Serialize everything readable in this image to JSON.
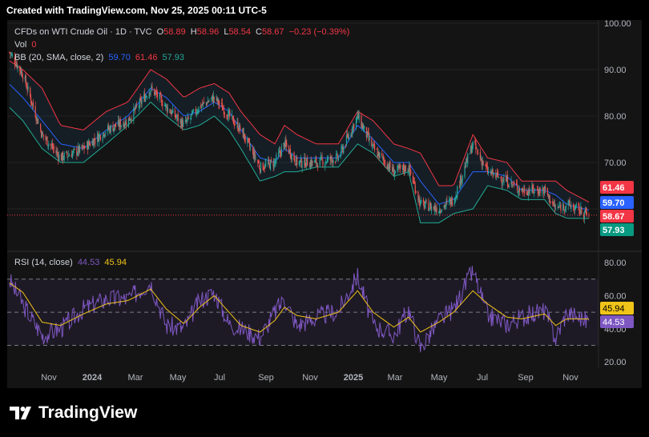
{
  "header": {
    "created_text": "Created with TradingView.com, Nov 25, 2025 00:11 UTC-5"
  },
  "legend": {
    "symbol": "CFDs on WTI Crude Oil · 1D · TVC",
    "ohlc": {
      "o_label": "O",
      "o": "58.89",
      "h_label": "H",
      "h": "58.96",
      "l_label": "L",
      "l": "58.54",
      "c_label": "C",
      "c": "58.67",
      "change": "−0.23 (−0.39%)"
    },
    "vol_label": "Vol",
    "vol": "0",
    "bb_label": "BB (20, SMA, close, 2)",
    "bb_mid": "59.70",
    "bb_upper": "61.46",
    "bb_lower": "57.93",
    "rsi_label": "RSI (14, close)",
    "rsi_value": "44.53",
    "rsi_ma": "45.94"
  },
  "colors": {
    "up": "#26a69a",
    "down": "#ef5350",
    "bb_upper": "#f23645",
    "bb_mid": "#2962ff",
    "bb_lower": "#22ab94",
    "rsi": "#7e57c2",
    "rsi_ma": "#f0c419",
    "background": "#141414"
  },
  "branding": {
    "logo_text": "TradingView"
  },
  "chart_data": [
    {
      "type": "candlestick",
      "title": "CFDs on WTI Crude Oil · 1D · TVC",
      "y_ticks": [
        "100.00",
        "90.00",
        "80.00",
        "70.00"
      ],
      "ylim": [
        50,
        100
      ],
      "x_ticks": [
        "Nov",
        "2024",
        "Mar",
        "May",
        "Jul",
        "Sep",
        "Nov",
        "2025",
        "Mar",
        "May",
        "Jul",
        "Sep",
        "Nov"
      ],
      "price_labels": {
        "bb_upper": "61.46",
        "bb_mid": "59.70",
        "last_close": "58.67",
        "bb_lower": "57.93"
      },
      "series": [
        {
          "name": "BB (20, SMA, close, 2)",
          "anchors": [
            [
              "2023-10-01",
              92,
              87,
              82
            ],
            [
              "2023-10-20",
              90,
              84,
              79
            ],
            [
              "2023-11-15",
              86,
              79,
              73
            ],
            [
              "2023-12-10",
              78,
              74,
              70
            ],
            [
              "2024-01-10",
              77,
              73,
              70
            ],
            [
              "2024-02-10",
              81,
              77,
              74
            ],
            [
              "2024-03-10",
              83,
              80,
              78
            ],
            [
              "2024-04-10",
              90,
              86,
              83
            ],
            [
              "2024-05-01",
              88,
              84,
              80
            ],
            [
              "2024-05-25",
              84,
              80,
              77
            ],
            [
              "2024-06-15",
              86,
              81,
              78
            ],
            [
              "2024-07-05",
              87,
              83,
              80
            ],
            [
              "2024-07-25",
              85,
              81,
              77
            ],
            [
              "2024-08-10",
              81,
              77,
              73
            ],
            [
              "2024-09-05",
              76,
              71,
              66
            ],
            [
              "2024-09-25",
              74,
              70,
              67
            ],
            [
              "2024-10-08",
              78,
              73,
              68
            ],
            [
              "2024-10-25",
              76,
              71,
              68
            ],
            [
              "2024-11-20",
              74,
              71,
              69
            ],
            [
              "2024-12-20",
              74,
              71,
              69
            ],
            [
              "2025-01-15",
              81,
              78,
              74
            ],
            [
              "2025-02-05",
              79,
              75,
              72
            ],
            [
              "2025-03-05",
              74,
              70,
              67
            ],
            [
              "2025-03-25",
              73,
              70,
              68
            ],
            [
              "2025-04-10",
              72,
              66,
              57
            ],
            [
              "2025-05-05",
              65,
              61,
              57
            ],
            [
              "2025-05-25",
              65,
              62,
              59
            ],
            [
              "2025-06-20",
              76,
              68,
              60
            ],
            [
              "2025-07-10",
              71,
              68,
              65
            ],
            [
              "2025-08-05",
              70,
              67,
              64
            ],
            [
              "2025-08-25",
              66,
              64,
              62
            ],
            [
              "2025-09-25",
              66,
              64,
              62
            ],
            [
              "2025-10-10",
              66,
              63,
              59
            ],
            [
              "2025-10-25",
              64,
              61,
              58
            ],
            [
              "2025-11-24",
              61.46,
              59.7,
              57.93
            ]
          ]
        },
        {
          "name": "close",
          "anchors": [
            [
              "2023-10-01",
              94
            ],
            [
              "2023-10-20",
              89
            ],
            [
              "2023-11-15",
              76
            ],
            [
              "2023-12-10",
              71
            ],
            [
              "2024-01-10",
              73
            ],
            [
              "2024-02-10",
              77
            ],
            [
              "2024-03-10",
              79
            ],
            [
              "2024-04-10",
              86
            ],
            [
              "2024-05-01",
              82
            ],
            [
              "2024-05-25",
              78
            ],
            [
              "2024-06-15",
              82
            ],
            [
              "2024-07-05",
              84
            ],
            [
              "2024-07-25",
              80
            ],
            [
              "2024-08-10",
              77
            ],
            [
              "2024-09-05",
              69
            ],
            [
              "2024-09-25",
              70
            ],
            [
              "2024-10-08",
              74
            ],
            [
              "2024-10-25",
              70
            ],
            [
              "2024-11-20",
              70
            ],
            [
              "2024-12-20",
              71
            ],
            [
              "2025-01-15",
              80
            ],
            [
              "2025-02-05",
              73
            ],
            [
              "2025-03-05",
              68
            ],
            [
              "2025-03-25",
              69
            ],
            [
              "2025-04-10",
              61
            ],
            [
              "2025-05-05",
              60
            ],
            [
              "2025-05-25",
              62
            ],
            [
              "2025-06-20",
              74
            ],
            [
              "2025-07-10",
              68
            ],
            [
              "2025-08-05",
              66
            ],
            [
              "2025-08-25",
              64
            ],
            [
              "2025-09-25",
              64
            ],
            [
              "2025-10-10",
              60
            ],
            [
              "2025-10-25",
              61
            ],
            [
              "2025-11-24",
              58.67
            ]
          ]
        }
      ]
    },
    {
      "type": "line",
      "title": "RSI (14, close)",
      "y_ticks": [
        "80.00",
        "60.00",
        "40.00",
        "20.00"
      ],
      "ylim": [
        20,
        80
      ],
      "bands": [
        30,
        50,
        70
      ],
      "value_labels": {
        "rsi_ma": "45.94",
        "rsi": "44.53"
      },
      "series": [
        {
          "name": "RSI",
          "anchors": [
            [
              "2023-10-01",
              70
            ],
            [
              "2023-10-20",
              55
            ],
            [
              "2023-11-15",
              36
            ],
            [
              "2023-12-10",
              40
            ],
            [
              "2024-01-10",
              52
            ],
            [
              "2024-02-10",
              58
            ],
            [
              "2024-03-10",
              58
            ],
            [
              "2024-04-10",
              68
            ],
            [
              "2024-05-01",
              42
            ],
            [
              "2024-05-25",
              40
            ],
            [
              "2024-06-15",
              57
            ],
            [
              "2024-07-05",
              62
            ],
            [
              "2024-07-25",
              43
            ],
            [
              "2024-08-10",
              40
            ],
            [
              "2024-09-05",
              35
            ],
            [
              "2024-09-25",
              50
            ],
            [
              "2024-10-08",
              58
            ],
            [
              "2024-10-25",
              42
            ],
            [
              "2024-11-20",
              47
            ],
            [
              "2024-12-20",
              51
            ],
            [
              "2025-01-15",
              72
            ],
            [
              "2025-02-05",
              42
            ],
            [
              "2025-03-05",
              36
            ],
            [
              "2025-03-25",
              52
            ],
            [
              "2025-04-10",
              28
            ],
            [
              "2025-05-05",
              45
            ],
            [
              "2025-05-25",
              52
            ],
            [
              "2025-06-20",
              75
            ],
            [
              "2025-07-10",
              48
            ],
            [
              "2025-08-05",
              43
            ],
            [
              "2025-08-25",
              47
            ],
            [
              "2025-09-25",
              51
            ],
            [
              "2025-10-10",
              34
            ],
            [
              "2025-10-25",
              50
            ],
            [
              "2025-11-24",
              44.53
            ]
          ]
        },
        {
          "name": "RSI-based MA",
          "anchors": [
            [
              "2023-10-01",
              68
            ],
            [
              "2023-10-20",
              62
            ],
            [
              "2023-11-15",
              44
            ],
            [
              "2023-12-10",
              42
            ],
            [
              "2024-01-10",
              49
            ],
            [
              "2024-02-10",
              55
            ],
            [
              "2024-03-10",
              57
            ],
            [
              "2024-04-10",
              64
            ],
            [
              "2024-05-01",
              52
            ],
            [
              "2024-05-25",
              43
            ],
            [
              "2024-06-15",
              53
            ],
            [
              "2024-07-05",
              60
            ],
            [
              "2024-07-25",
              50
            ],
            [
              "2024-08-10",
              42
            ],
            [
              "2024-09-05",
              38
            ],
            [
              "2024-09-25",
              45
            ],
            [
              "2024-10-08",
              53
            ],
            [
              "2024-10-25",
              48
            ],
            [
              "2024-11-20",
              46
            ],
            [
              "2024-12-20",
              50
            ],
            [
              "2025-01-15",
              63
            ],
            [
              "2025-02-05",
              50
            ],
            [
              "2025-03-05",
              41
            ],
            [
              "2025-03-25",
              47
            ],
            [
              "2025-04-10",
              38
            ],
            [
              "2025-05-05",
              44
            ],
            [
              "2025-05-25",
              50
            ],
            [
              "2025-06-20",
              63
            ],
            [
              "2025-07-10",
              55
            ],
            [
              "2025-08-05",
              47
            ],
            [
              "2025-08-25",
              46
            ],
            [
              "2025-09-25",
              49
            ],
            [
              "2025-10-10",
              42
            ],
            [
              "2025-10-25",
              46
            ],
            [
              "2025-11-24",
              45.94
            ]
          ]
        }
      ]
    }
  ]
}
